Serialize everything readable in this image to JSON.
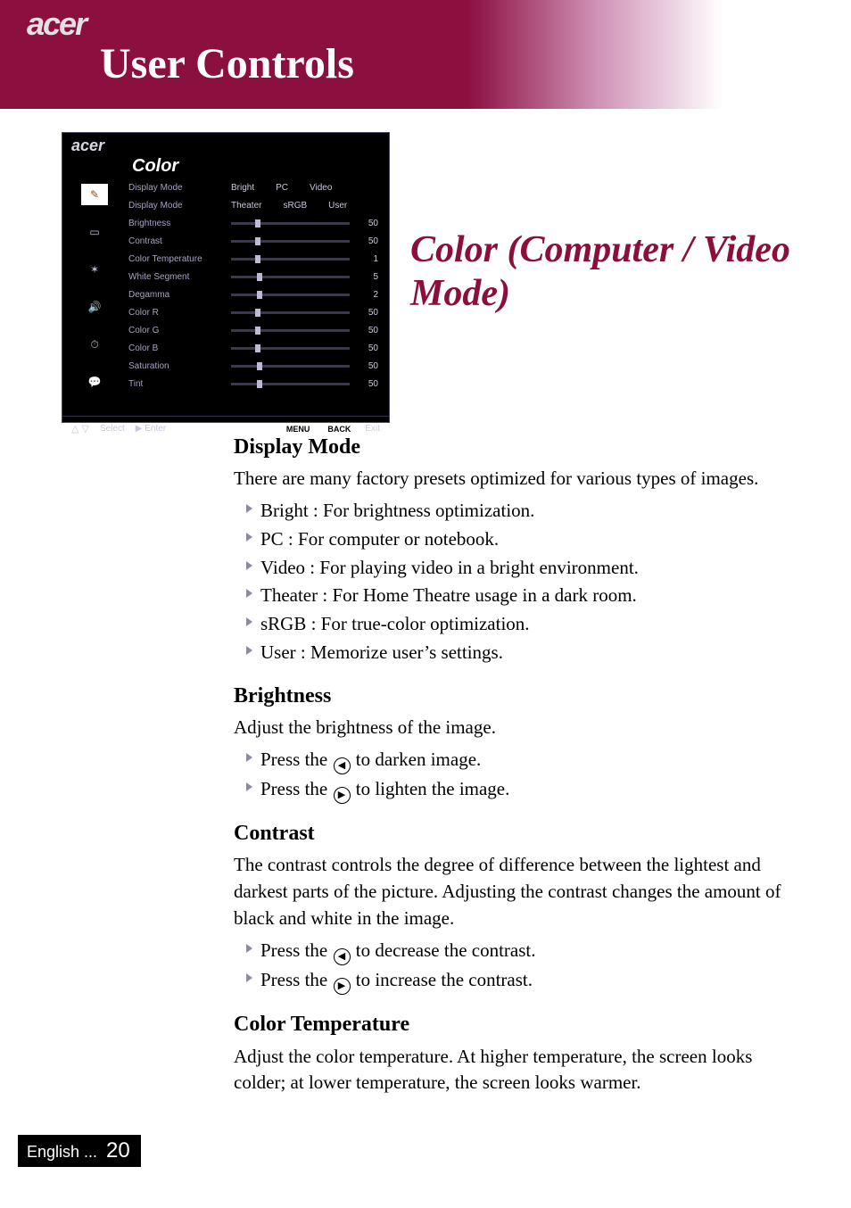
{
  "brand": "acer",
  "page_heading": "User Controls",
  "section_title": "Color (Computer / Video Mode)",
  "osd": {
    "brand": "acer",
    "title": "Color",
    "side_icons": [
      "brush",
      "image",
      "gear",
      "sound",
      "timer",
      "lang"
    ],
    "mode_rows": [
      {
        "label": "Display Mode",
        "options": [
          "Bright",
          "PC",
          "Video"
        ]
      },
      {
        "label": "Display Mode",
        "options": [
          "Theater",
          "sRGB",
          "User"
        ]
      }
    ],
    "sliders": [
      {
        "label": "Brightness",
        "value": 50,
        "pos": 20
      },
      {
        "label": "Contrast",
        "value": 50,
        "pos": 20
      },
      {
        "label": "Color Temperature",
        "value": 1,
        "pos": 20
      },
      {
        "label": "White Segment",
        "value": 5,
        "pos": 22
      },
      {
        "label": "Degamma",
        "value": 2,
        "pos": 22
      },
      {
        "label": "Color R",
        "value": 50,
        "pos": 20
      },
      {
        "label": "Color G",
        "value": 50,
        "pos": 20
      },
      {
        "label": "Color B",
        "value": 50,
        "pos": 20
      },
      {
        "label": "Saturation",
        "value": 50,
        "pos": 22
      },
      {
        "label": "Tint",
        "value": 50,
        "pos": 22
      }
    ],
    "footer": {
      "select": "Select",
      "enter": "Enter",
      "menu": "MENU",
      "back": "BACK",
      "exit": "Exit"
    }
  },
  "sections": {
    "display_mode": {
      "heading": "Display Mode",
      "intro": "There are many factory presets optimized for various types of images.",
      "items": [
        "Bright : For brightness optimization.",
        "PC : For computer or notebook.",
        "Video : For playing video in a bright environment.",
        "Theater : For Home Theatre usage in a dark room.",
        "sRGB : For true-color optimization.",
        "User : Memorize user’s settings."
      ]
    },
    "brightness": {
      "heading": "Brightness",
      "intro": "Adjust the brightness of the image.",
      "press_left_before": "Press the ",
      "press_left_after": " to darken image.",
      "press_right_before": "Press the ",
      "press_right_after": " to lighten the image."
    },
    "contrast": {
      "heading": "Contrast",
      "intro": "The contrast controls the degree of difference between the lightest and darkest parts of the picture. Adjusting the contrast changes the amount of black and white in the image.",
      "press_left_before": "Press the ",
      "press_left_after": " to decrease the contrast.",
      "press_right_before": "Press the ",
      "press_right_after": " to increase the contrast."
    },
    "color_temp": {
      "heading": "Color Temperature",
      "intro": "Adjust the color temperature. At higher temperature, the screen looks colder; at lower temperature, the screen looks warmer."
    }
  },
  "footer": {
    "lang": "English ...",
    "page": "20"
  }
}
